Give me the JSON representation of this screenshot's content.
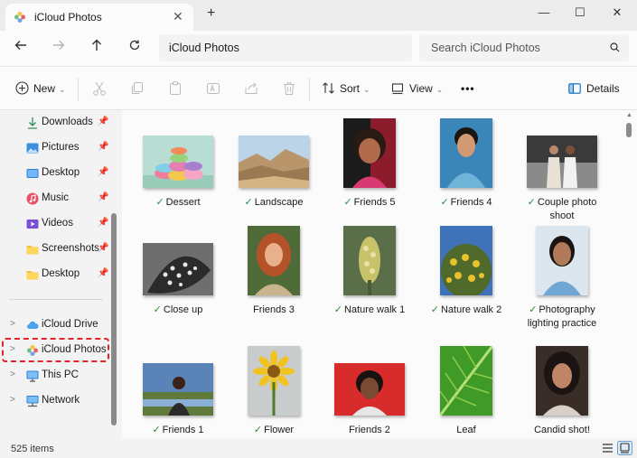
{
  "window": {
    "tab_title": "iCloud Photos",
    "tab_close": "✕",
    "new_tab": "+",
    "minimize": "—",
    "maximize": "☐",
    "close": "✕"
  },
  "address": {
    "path": "iCloud Photos",
    "search_placeholder": "Search iCloud Photos"
  },
  "toolbar": {
    "new_label": "New",
    "sort_label": "Sort",
    "view_label": "View",
    "more_label": "•••",
    "details_label": "Details"
  },
  "sidebar": {
    "quick": [
      {
        "label": "Downloads",
        "icon": "download-icon"
      },
      {
        "label": "Pictures",
        "icon": "pictures-icon"
      },
      {
        "label": "Desktop",
        "icon": "desktop-icon"
      },
      {
        "label": "Music",
        "icon": "music-icon"
      },
      {
        "label": "Videos",
        "icon": "videos-icon"
      },
      {
        "label": "Screenshots",
        "icon": "folder-icon"
      },
      {
        "label": "Desktop",
        "icon": "folder-icon"
      }
    ],
    "tree": [
      {
        "label": "iCloud Drive",
        "icon": "cloud-icon"
      },
      {
        "label": "iCloud Photos",
        "icon": "photos-icon"
      },
      {
        "label": "This PC",
        "icon": "pc-icon"
      },
      {
        "label": "Network",
        "icon": "network-icon"
      }
    ]
  },
  "items": [
    {
      "name": "Dessert",
      "synced": true
    },
    {
      "name": "Landscape",
      "synced": true
    },
    {
      "name": "Friends 5",
      "synced": true
    },
    {
      "name": "Friends 4",
      "synced": true
    },
    {
      "name": "Couple photo shoot",
      "synced": true
    },
    {
      "name": "Close up",
      "synced": true
    },
    {
      "name": "Friends 3",
      "synced": false
    },
    {
      "name": "Nature walk 1",
      "synced": true
    },
    {
      "name": "Nature walk 2",
      "synced": true
    },
    {
      "name": "Photography lighting practice",
      "synced": true
    },
    {
      "name": "Friends 1",
      "synced": true
    },
    {
      "name": "Flower",
      "synced": true
    },
    {
      "name": "Friends 2",
      "synced": false
    },
    {
      "name": "Leaf",
      "synced": false
    },
    {
      "name": "Candid shot!",
      "synced": false
    }
  ],
  "status": {
    "count": "525 items"
  },
  "colors": {
    "accent": "#0067c0",
    "highlight": "#e0252a",
    "synced": "#2a8a3a"
  }
}
